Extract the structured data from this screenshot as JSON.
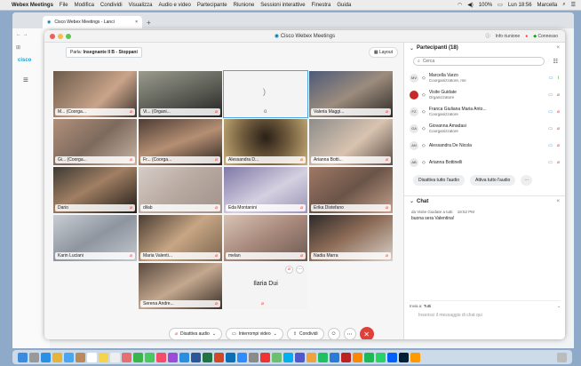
{
  "menubar": {
    "app": "Webex Meetings",
    "items": [
      "File",
      "Modifica",
      "Condividi",
      "Visualizza",
      "Audio e video",
      "Partecipante",
      "Riunione",
      "Sessioni interattive",
      "Finestra",
      "Guida"
    ],
    "battery": "100%",
    "clock": "Lun 18:56",
    "user": "Marcella"
  },
  "browser": {
    "tab_title": "Cisco Webex Meetings - Lanci",
    "new_tab": "+",
    "logo": "cisco"
  },
  "window": {
    "title": "Cisco Webex Meetings",
    "info": "Info riunione",
    "connected": "Connesso"
  },
  "video": {
    "speaker_prefix": "Parla:",
    "speaker_name": "Insegnante II B - Stoppani",
    "layout_label": "Layout",
    "tiles": [
      {
        "name": "M... (Coorga..."
      },
      {
        "name": "Vi... (Organi..."
      },
      {
        "name": ""
      },
      {
        "name": "Valeria Maggi..."
      },
      {
        "name": "Gi... (Coorga..."
      },
      {
        "name": "Fr... (Coorga..."
      },
      {
        "name": "Alessandra D..."
      },
      {
        "name": "Arianna Botti..."
      },
      {
        "name": "Dario"
      },
      {
        "name": "dilab"
      },
      {
        "name": "Eda Montanini"
      },
      {
        "name": "Erika Distefano"
      },
      {
        "name": "Karin Luciani"
      },
      {
        "name": "Maria Valenti..."
      },
      {
        "name": "melan"
      },
      {
        "name": "Nadia Marra"
      },
      {
        "name": "Serena Andre..."
      },
      {
        "name": "Ilaria Dui"
      }
    ]
  },
  "controls": {
    "mute": "Disattiva audio",
    "video": "Interrompi video",
    "share": "Condividi"
  },
  "participants": {
    "title": "Partecipanti (18)",
    "search_placeholder": "Cerca",
    "list": [
      {
        "initials": "MV",
        "name": "Marcella Varzo",
        "role": "Coorganizzatore, me"
      },
      {
        "initials": "",
        "name": "Visite Guidate",
        "role": "Organizzatore"
      },
      {
        "initials": "FZ",
        "name": "Franca Giuliana Maria Anto...",
        "role": "Coorganizzatore"
      },
      {
        "initials": "GA",
        "name": "Giovanna Amadasi",
        "role": "Coorganizzatore"
      },
      {
        "initials": "AN",
        "name": "Alessandra De Nicola",
        "role": ""
      },
      {
        "initials": "AB",
        "name": "Arianna Bottinelli",
        "role": ""
      }
    ],
    "mute_all": "Disattiva tutto l'audio",
    "unmute_all": "Attiva tutto l'audio"
  },
  "chat": {
    "title": "Chat",
    "from": "da Visite Guidate a tutti",
    "time": "18:52 PM",
    "message": "buona sera Valentina!",
    "to_label": "Invia a:",
    "to_value": "Tutti",
    "placeholder": "Inserisci il messaggio di chat qui"
  },
  "colors": {
    "accent": "#49a5e8",
    "end_call": "#e0403a",
    "mic_muted": "#e33333"
  }
}
